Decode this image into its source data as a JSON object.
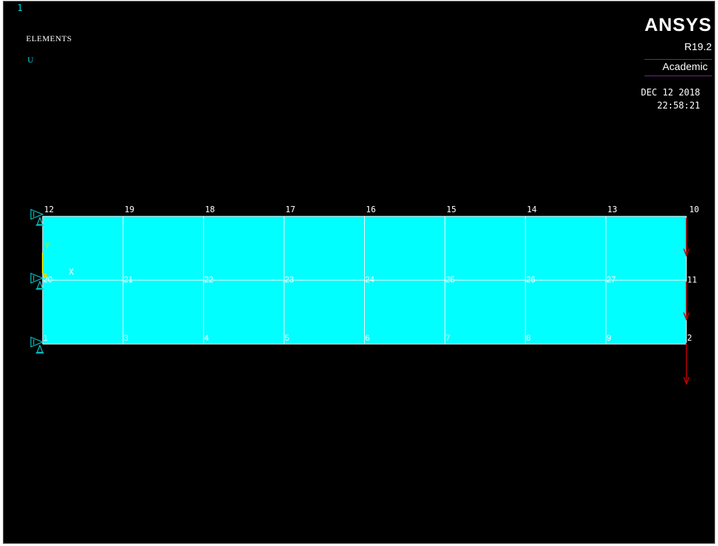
{
  "header": {
    "window_number": "1",
    "plot_type": "ELEMENTS",
    "dof_label": "U"
  },
  "branding": {
    "logo": "ANSYS",
    "release": "R19.2",
    "license": "Academic"
  },
  "datetime": {
    "date": "DEC 12 2018",
    "time": "22:58:21"
  },
  "mesh": {
    "top_nodes": [
      "12",
      "19",
      "18",
      "17",
      "16",
      "15",
      "14",
      "13",
      "10"
    ],
    "mid_nodes": [
      "20",
      "21",
      "22",
      "23",
      "24",
      "25",
      "26",
      "27",
      "11"
    ],
    "bottom_nodes": [
      "1",
      "3",
      "4",
      "5",
      "6",
      "7",
      "8",
      "9",
      "2"
    ]
  },
  "triad": {
    "x_label": "X",
    "y_label": "Y"
  },
  "colors": {
    "background": "#000000",
    "element_fill": "#00ffff",
    "element_edges": "#ffffff",
    "constraint_symbols": "#00d0d0",
    "load_arrows": "#c00000",
    "x_axis": "#ffffff",
    "y_axis": "#c8e000"
  },
  "icons": {
    "constraint": "displacement-constraint-icon",
    "load": "force-arrow-icon"
  }
}
